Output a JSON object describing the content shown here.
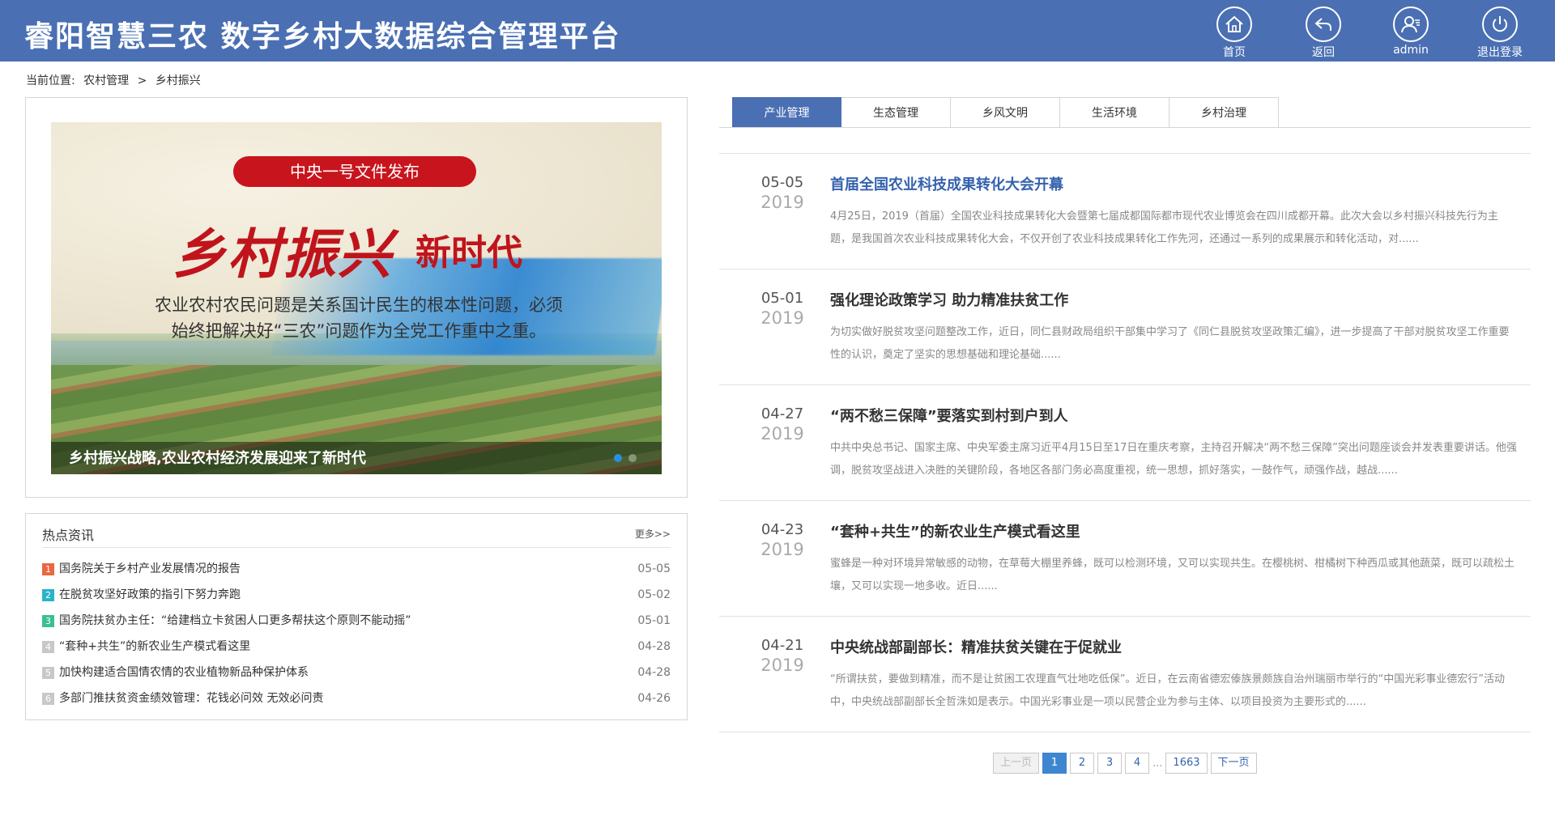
{
  "app": {
    "title": "睿阳智慧三农  数字乡村大数据综合管理平台"
  },
  "header_buttons": [
    {
      "label": "首页",
      "icon": "home-icon"
    },
    {
      "label": "返回",
      "icon": "back-icon"
    },
    {
      "label": "admin",
      "icon": "user-icon"
    },
    {
      "label": "退出登录",
      "icon": "power-icon"
    }
  ],
  "breadcrumb": {
    "prefix": "当前位置:",
    "level1": "农村管理",
    "separator": ">",
    "level2": "乡村振兴"
  },
  "banner": {
    "pill_text": "中央一号文件发布",
    "headline_main": "乡村振兴",
    "headline_side": "新时代",
    "subtext_line1": "农业农村农民问题是关系国计民生的根本性问题，必须",
    "subtext_line2": "始终把解决好“三农”问题作为全党工作重中之重。",
    "caption": "乡村振兴战略,农业农村经济发展迎来了新时代",
    "active_slide": 1,
    "slide_count": 2
  },
  "hot_news": {
    "title": "热点资讯",
    "more_label": "更多>>",
    "items": [
      {
        "num": "1",
        "color": "#e8683f",
        "text": "国务院关于乡村产业发展情况的报告",
        "date": "05-05"
      },
      {
        "num": "2",
        "color": "#2ab3c9",
        "text": "在脱贫攻坚好政策的指引下努力奔跑",
        "date": "05-02"
      },
      {
        "num": "3",
        "color": "#3cbf8e",
        "text": "国务院扶贫办主任：“给建档立卡贫困人口更多帮扶这个原则不能动摇”",
        "date": "05-01"
      },
      {
        "num": "4",
        "color": "#c8c8c8",
        "text": "“套种+共生”的新农业生产模式看这里",
        "date": "04-28"
      },
      {
        "num": "5",
        "color": "#c8c8c8",
        "text": "加快构建适合国情农情的农业植物新品种保护体系",
        "date": "04-28"
      },
      {
        "num": "6",
        "color": "#c8c8c8",
        "text": "多部门推扶贫资金绩效管理：花钱必问效 无效必问责",
        "date": "04-26"
      }
    ]
  },
  "tabs": [
    {
      "label": "产业管理",
      "active": true
    },
    {
      "label": "生态管理",
      "active": false
    },
    {
      "label": "乡风文明",
      "active": false
    },
    {
      "label": "生活环境",
      "active": false
    },
    {
      "label": "乡村治理",
      "active": false
    }
  ],
  "articles": [
    {
      "md": "05-05",
      "year": "2019",
      "highlight": true,
      "title": "首届全国农业科技成果转化大会开幕",
      "desc": "4月25日，2019（首届）全国农业科技成果转化大会暨第七届成都国际都市现代农业博览会在四川成都开幕。此次大会以乡村振兴科技先行为主题，是我国首次农业科技成果转化大会，不仅开创了农业科技成果转化工作先河，还通过一系列的成果展示和转化活动，对......"
    },
    {
      "md": "05-01",
      "year": "2019",
      "highlight": false,
      "title": "强化理论政策学习 助力精准扶贫工作",
      "desc": " 为切实做好脱贫攻坚问题整改工作，近日，同仁县财政局组织干部集中学习了《同仁县脱贫攻坚政策汇编》，进一步提高了干部对脱贫攻坚工作重要性的认识，奠定了坚实的思想基础和理论基础......"
    },
    {
      "md": "04-27",
      "year": "2019",
      "highlight": false,
      "title": "“两不愁三保障”要落实到村到户到人",
      "desc": "中共中央总书记、国家主席、中央军委主席习近平4月15日至17日在重庆考察，主持召开解决“两不愁三保障”突出问题座谈会并发表重要讲话。他强调，脱贫攻坚战进入决胜的关键阶段，各地区各部门务必高度重视，统一思想，抓好落实，一鼓作气，顽强作战，越战......"
    },
    {
      "md": "04-23",
      "year": "2019",
      "highlight": false,
      "title": "“套种+共生”的新农业生产模式看这里",
      "desc": "蜜蜂是一种对环境异常敏感的动物，在草莓大棚里养蜂，既可以检测环境，又可以实现共生。在樱桃树、柑橘树下种西瓜或其他蔬菜，既可以疏松土壤，又可以实现一地多收。近日......"
    },
    {
      "md": "04-21",
      "year": "2019",
      "highlight": false,
      "title": "中央统战部副部长：精准扶贫关键在于促就业",
      "desc": "“所谓扶贫，要做到精准，而不是让贫困工农理直气壮地吃低保”。近日，在云南省德宏傣族景颇族自治州瑞丽市举行的“中国光彩事业德宏行”活动中，中央统战部副部长全哲洙如是表示。中国光彩事业是一项以民营企业为参与主体、以项目投资为主要形式的......"
    }
  ],
  "pagination": {
    "prev": "上一页",
    "pages": [
      "1",
      "2",
      "3",
      "4"
    ],
    "ellipsis": "...",
    "last": "1663",
    "next": "下一页",
    "current": "1"
  },
  "colors": {
    "header_bg": "#4a6fb3",
    "accent_blue": "#3562ad",
    "active_page": "#3f86d1",
    "banner_pill": "#c8151d"
  }
}
